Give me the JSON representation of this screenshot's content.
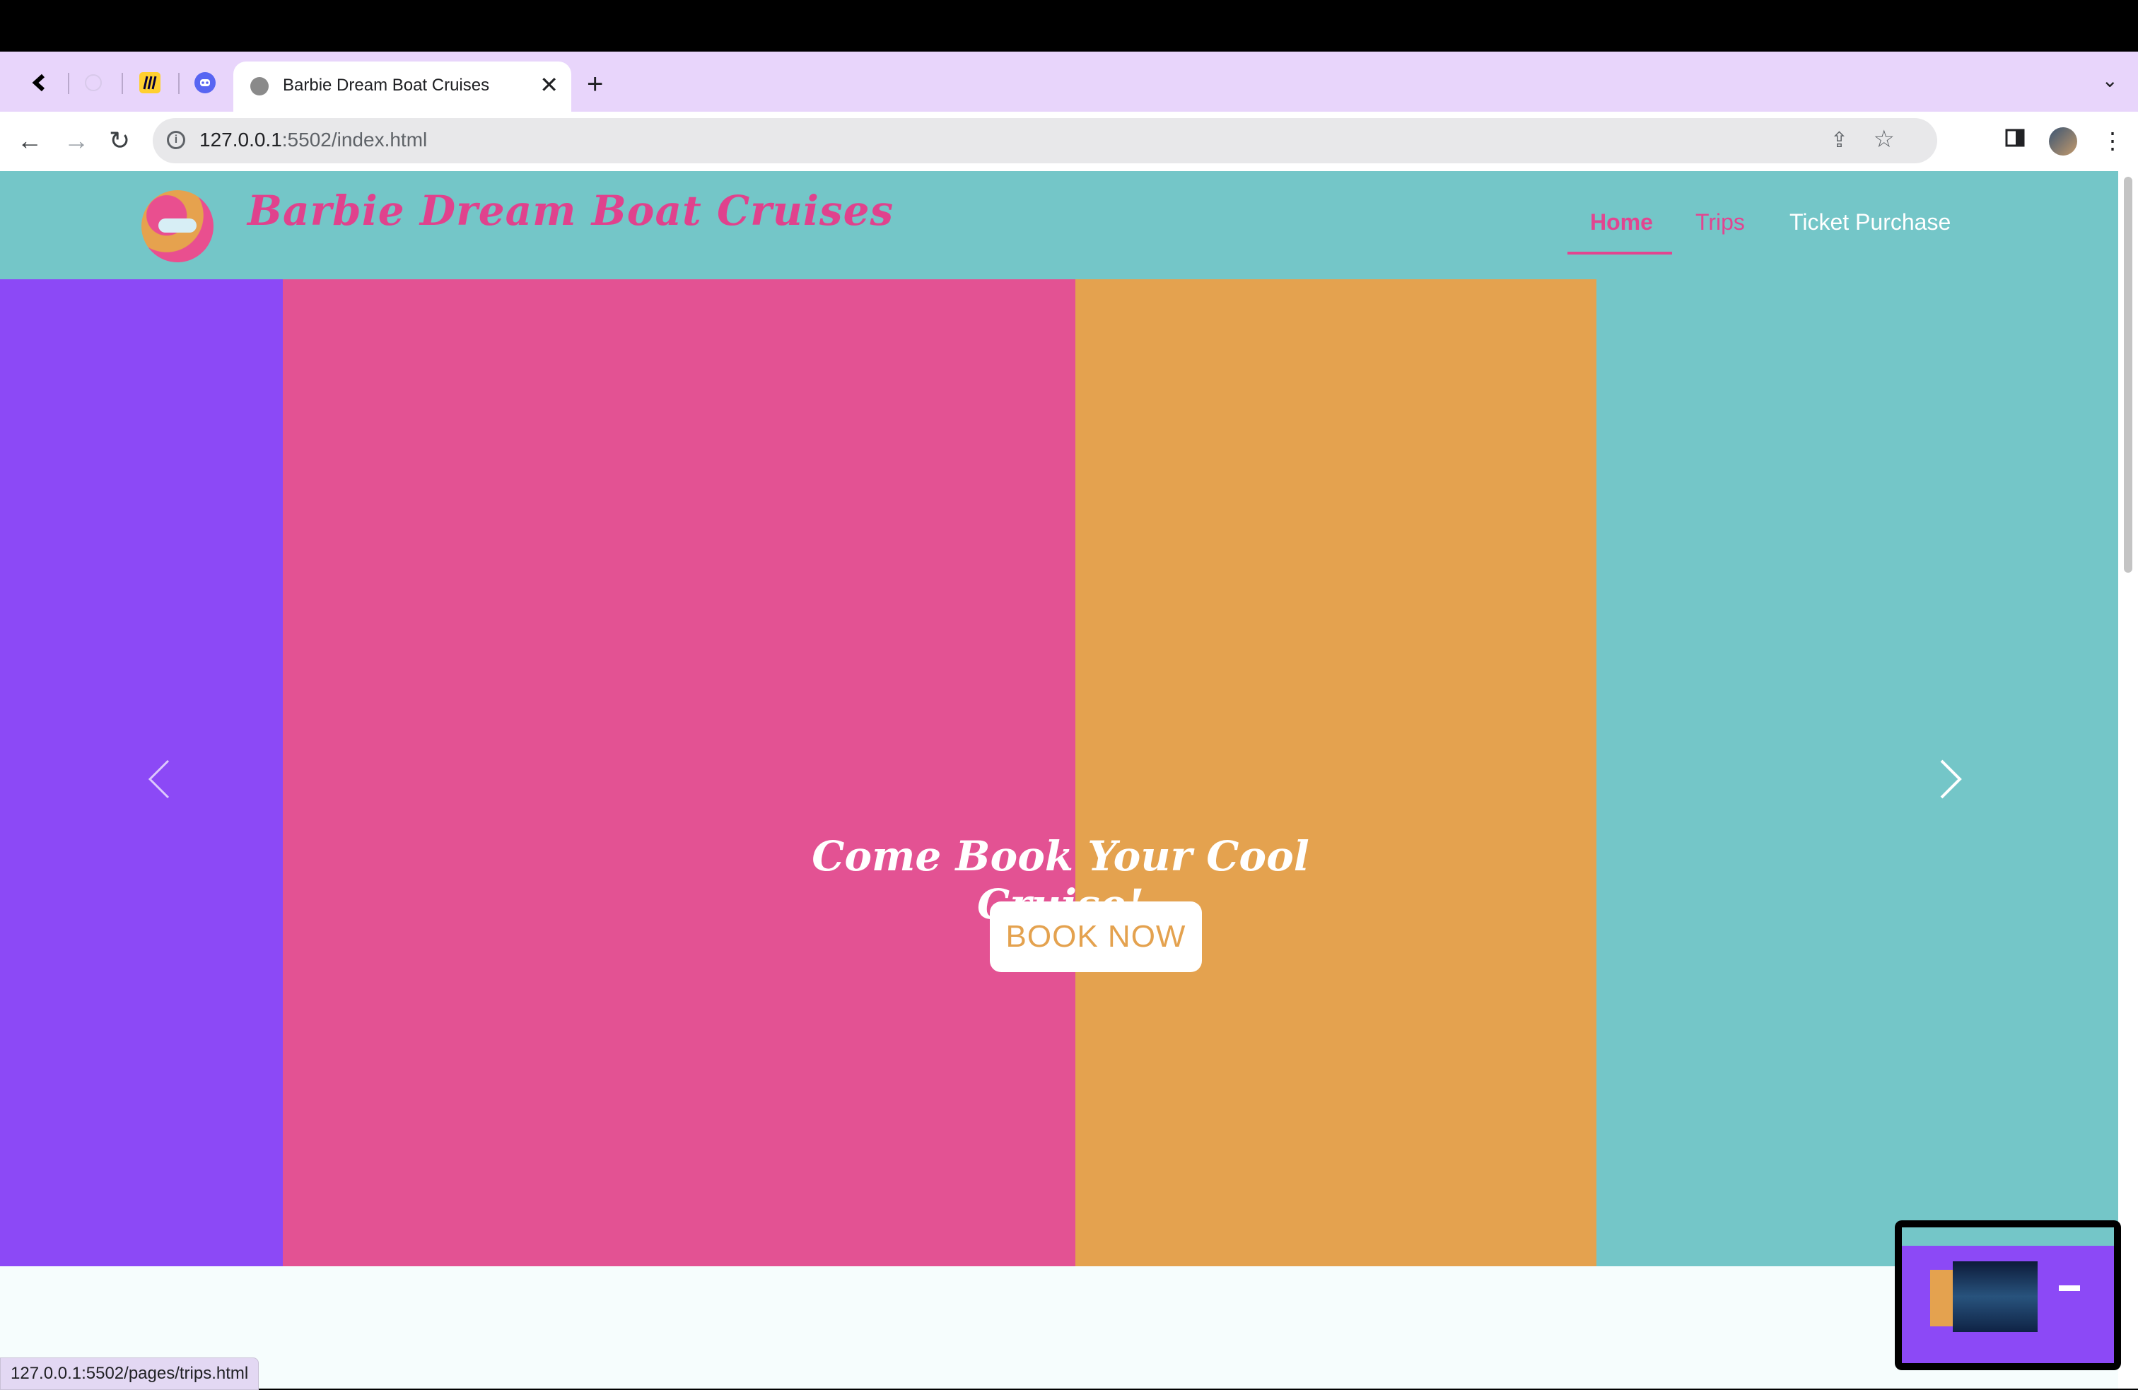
{
  "browser": {
    "active_tab_title": "Barbie Dream Boat Cruises",
    "url_host": "127.0.0.1",
    "url_rest": ":5502/index.html",
    "status_url": "127.0.0.1:5502/pages/trips.html",
    "pinned_tabs": [
      "back-arrow-tab-icon",
      "blank-tab-icon",
      "miro-tab-icon",
      "discord-tab-icon"
    ]
  },
  "site": {
    "brand": "Barbie Dream Boat Cruises",
    "nav": {
      "home": "Home",
      "trips": "Trips",
      "ticket": "Ticket Purchase"
    },
    "hero": {
      "caption": "Come Book Your Cool Cruise!",
      "cta": "BOOK NOW",
      "slide_count": 3,
      "active_slide": 2
    },
    "colors": {
      "header": "#74c6c8",
      "purple": "#8c49f6",
      "pink": "#e35293",
      "orange": "#e4a24f",
      "teal": "#74c6c8",
      "accent": "#e24590"
    }
  }
}
